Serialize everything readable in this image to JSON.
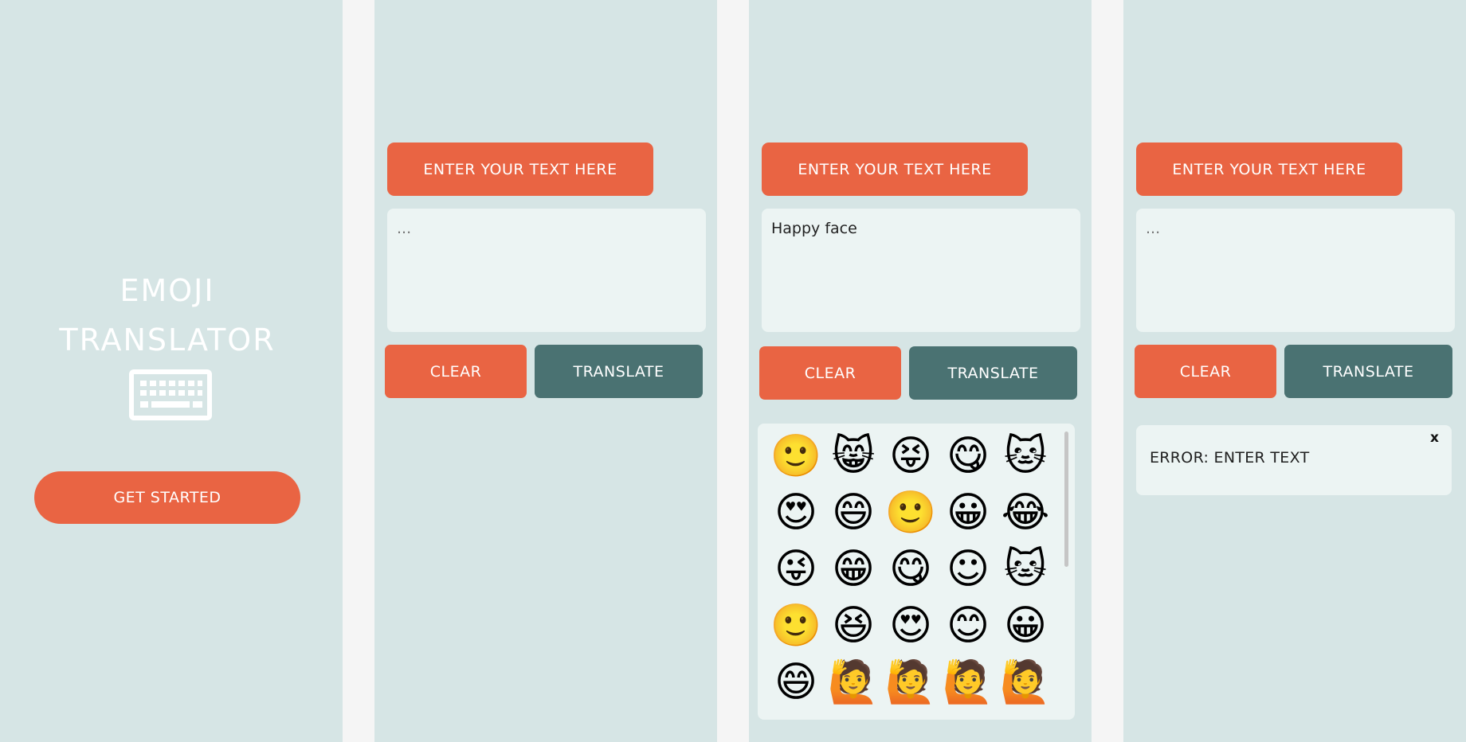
{
  "screen1": {
    "title_line1": "EMOJI",
    "title_line2": "TRANSLATOR",
    "get_started_label": "GET STARTED"
  },
  "screen2": {
    "header_label": "ENTER YOUR TEXT HERE",
    "input_placeholder": "...",
    "input_value": "",
    "clear_label": "CLEAR",
    "translate_label": "TRANSLATE"
  },
  "screen3": {
    "header_label": "ENTER YOUR TEXT HERE",
    "input_placeholder": "...",
    "input_value": "Happy face",
    "clear_label": "CLEAR",
    "translate_label": "TRANSLATE",
    "emojis": [
      "🙂",
      "😸",
      "😝",
      "😋",
      "🐱",
      "😍",
      "😄",
      "🙂",
      "😀",
      "😂",
      "😜",
      "😁",
      "😋",
      "☺",
      "🐱",
      "🙂",
      "😆",
      "😍",
      "😊",
      "😀",
      "😄",
      "🙋",
      "🙋",
      "🙋",
      "🙋"
    ]
  },
  "screen4": {
    "header_label": "ENTER YOUR TEXT HERE",
    "input_placeholder": "...",
    "input_value": "",
    "clear_label": "CLEAR",
    "translate_label": "TRANSLATE",
    "error_text": "ERROR: ENTER TEXT",
    "close_label": "x"
  },
  "colors": {
    "panel_bg": "#d6e5e5",
    "accent_orange": "#e96443",
    "accent_teal": "#4a7272",
    "field_bg": "#ecf4f3"
  },
  "icons": {
    "logo": "keyboard-icon"
  }
}
